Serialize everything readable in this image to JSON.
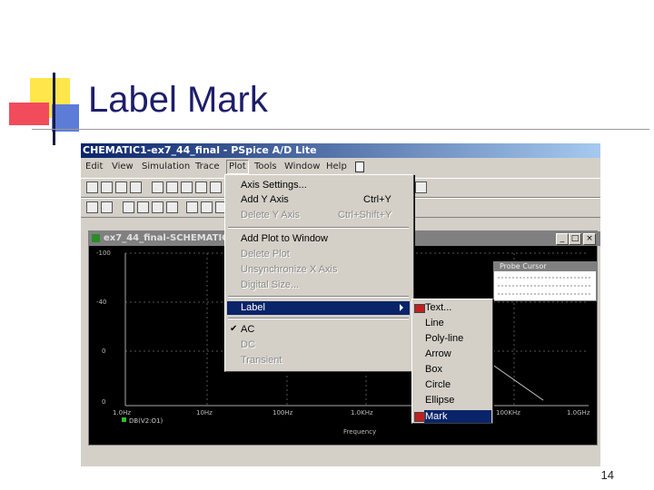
{
  "slide": {
    "title": "Label Mark",
    "page_number": "14"
  },
  "app": {
    "window_title": "CHEMATIC1-ex7_44_final - PSpice A/D Lite"
  },
  "menubar": [
    "Edit",
    "View",
    "Simulation",
    "Trace",
    "Plot",
    "Tools",
    "Window",
    "Help"
  ],
  "probe_window": {
    "title": "ex7_44_final-SCHEMATIC",
    "y_ticks": [
      "-100",
      "-40",
      "0",
      "0"
    ],
    "x_ticks": [
      "1.0Hz",
      "10Hz",
      "100Hz",
      "1.0KHz",
      "100KHz",
      "1.0GHz"
    ],
    "x_label": "Frequency",
    "trace_label": "DB(V2:O1)"
  },
  "probe_cursor": {
    "title": "Probe Cursor"
  },
  "plot_menu": {
    "items": [
      {
        "label": "Axis Settings...",
        "disabled": false
      },
      {
        "label": "Add Y Axis",
        "shortcut": "Ctrl+Y",
        "disabled": false
      },
      {
        "label": "Delete Y Axis",
        "shortcut": "Ctrl+Shift+Y",
        "disabled": true
      },
      {
        "label": "Add Plot to Window",
        "disabled": false
      },
      {
        "label": "Delete Plot",
        "disabled": true
      },
      {
        "label": "Unsynchronize X Axis",
        "disabled": true
      },
      {
        "label": "Digital Size...",
        "disabled": true
      },
      {
        "label": "Label",
        "highlighted": true
      },
      {
        "label": "AC",
        "checked": true
      },
      {
        "label": "DC",
        "disabled": true
      },
      {
        "label": "Transient",
        "disabled": true
      }
    ]
  },
  "label_submenu": {
    "items": [
      "Text...",
      "Line",
      "Poly-line",
      "Arrow",
      "Box",
      "Circle",
      "Ellipse",
      "Mark"
    ],
    "selected": "Mark"
  },
  "colors": {
    "title": "#1d1d6b",
    "highlight": "#0a246a",
    "plot_bg": "#000000"
  }
}
